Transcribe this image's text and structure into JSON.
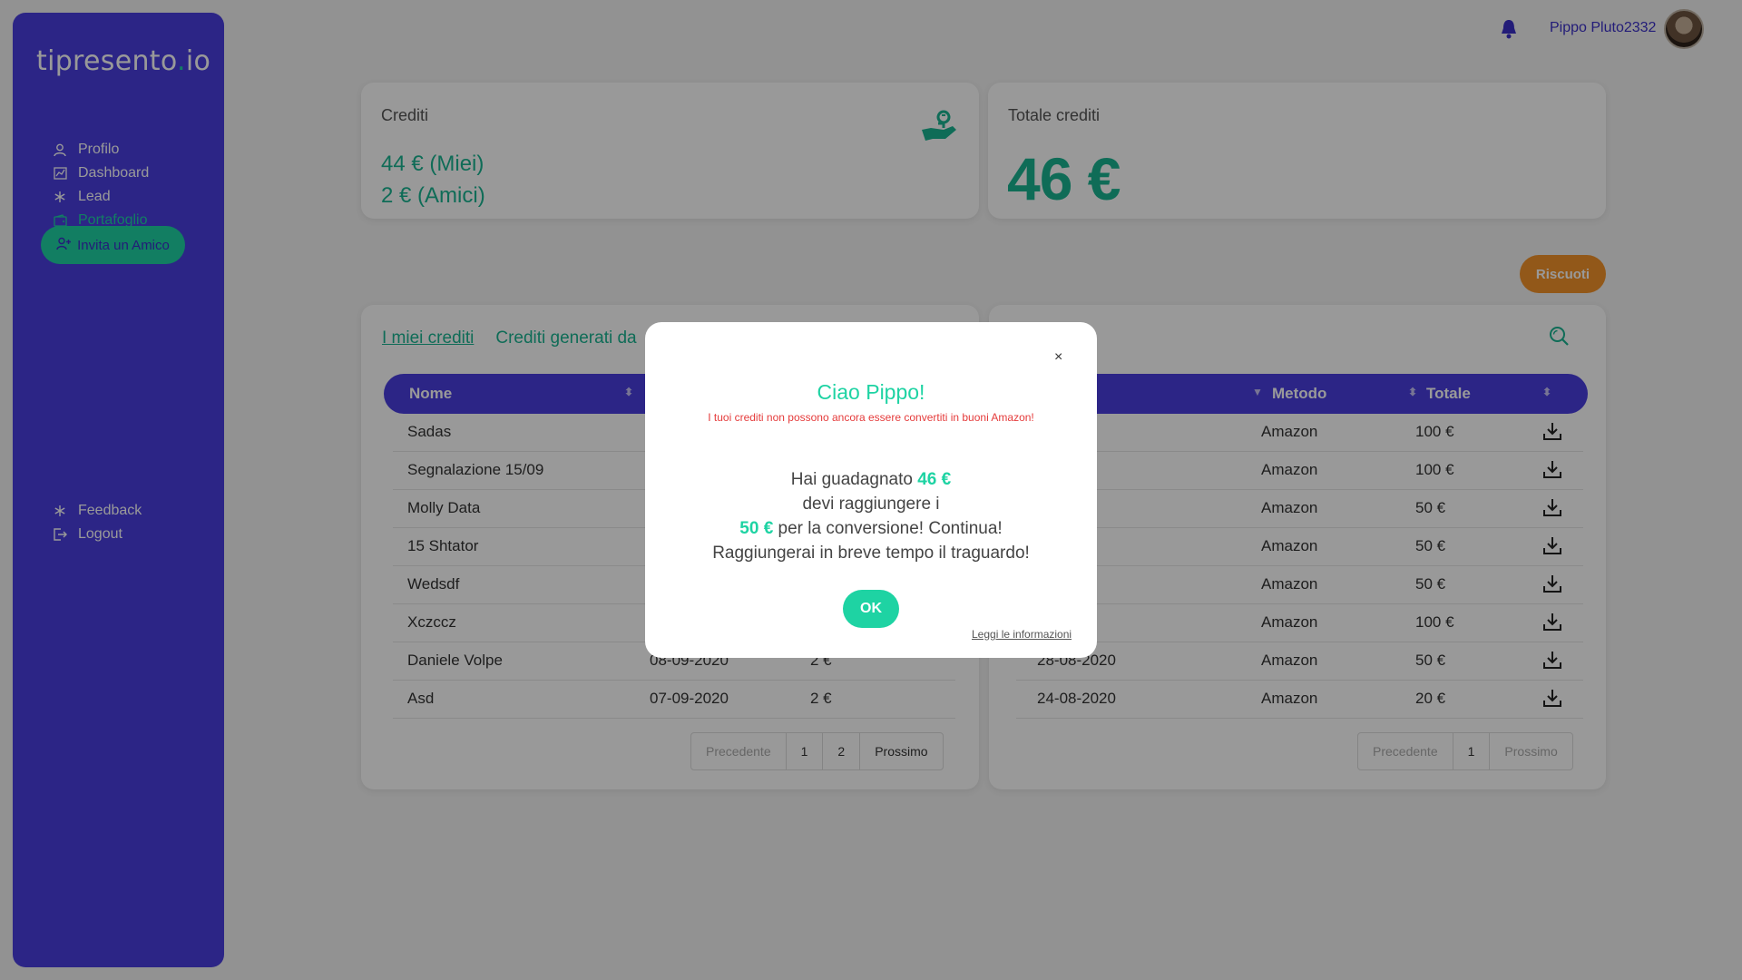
{
  "sidebar": {
    "logo": "tipresento",
    "logo_dot": ".",
    "logo_suffix": "io",
    "items": [
      {
        "label": "Profilo",
        "icon": "user-icon"
      },
      {
        "label": "Dashboard",
        "icon": "chart-icon"
      },
      {
        "label": "Lead",
        "icon": "asterisk-icon"
      },
      {
        "label": "Portafoglio",
        "icon": "wallet-icon",
        "active": true
      }
    ],
    "invite_label": "Invita un Amico",
    "bottom_items": [
      {
        "label": "Feedback",
        "icon": "asterisk-icon"
      },
      {
        "label": "Logout",
        "icon": "logout-icon"
      }
    ]
  },
  "header": {
    "username": "Pippo Pluto2332"
  },
  "credits_card": {
    "title": "Crediti",
    "mine": "44 € (Miei)",
    "friends": "2 € (Amici)"
  },
  "total_card": {
    "title": "Totale crediti",
    "value": "46 €"
  },
  "riscuoti_label": "Riscuoti",
  "left_panel": {
    "tabs": [
      "I miei crediti",
      "Crediti generati da"
    ],
    "columns": [
      "Nome"
    ],
    "rows": [
      {
        "nome": "Sadas",
        "data": "",
        "valore": ""
      },
      {
        "nome": "Segnalazione 15/09",
        "data": "",
        "valore": ""
      },
      {
        "nome": "Molly Data",
        "data": "",
        "valore": ""
      },
      {
        "nome": "15 Shtator",
        "data": "",
        "valore": ""
      },
      {
        "nome": "Wedsdf",
        "data": "",
        "valore": ""
      },
      {
        "nome": "Xczccz",
        "data": "",
        "valore": ""
      },
      {
        "nome": "Daniele Volpe",
        "data": "08-09-2020",
        "valore": "2 €"
      },
      {
        "nome": "Asd",
        "data": "07-09-2020",
        "valore": "2 €"
      }
    ],
    "pager": [
      "Precedente",
      "1",
      "2",
      "Prossimo"
    ]
  },
  "right_panel": {
    "columns": [
      "Metodo",
      "Totale"
    ],
    "rows": [
      {
        "data": "20",
        "metodo": "Amazon",
        "totale": "100 €"
      },
      {
        "data": "20",
        "metodo": "Amazon",
        "totale": "100 €"
      },
      {
        "data": "020",
        "metodo": "Amazon",
        "totale": "50 €"
      },
      {
        "data": "020",
        "metodo": "Amazon",
        "totale": "50 €"
      },
      {
        "data": "020",
        "metodo": "Amazon",
        "totale": "50 €"
      },
      {
        "data": "020",
        "metodo": "Amazon",
        "totale": "100 €"
      },
      {
        "data": "28-08-2020",
        "metodo": "Amazon",
        "totale": "50 €"
      },
      {
        "data": "24-08-2020",
        "metodo": "Amazon",
        "totale": "20 €"
      }
    ],
    "pager": [
      "Precedente",
      "1",
      "Prossimo"
    ]
  },
  "modal": {
    "title": "Ciao Pippo!",
    "warning": "I tuoi crediti non possono ancora essere convertiti in buoni Amazon!",
    "line1_pre": "Hai guadagnato ",
    "line1_amount": "46 €",
    "line2": "devi raggiungere i",
    "line3_amount": "50 €",
    "line3_post": " per la conversione! Continua!",
    "line4": "Raggiungerai in breve tempo il traguardo!",
    "ok_label": "OK",
    "info_link": "Leggi le informazioni",
    "close": "×"
  },
  "colors": {
    "primary": "#4a3fe0",
    "accent": "#1ed3a3",
    "warning": "#e53b3b",
    "riscuoti": "#f3932a"
  }
}
